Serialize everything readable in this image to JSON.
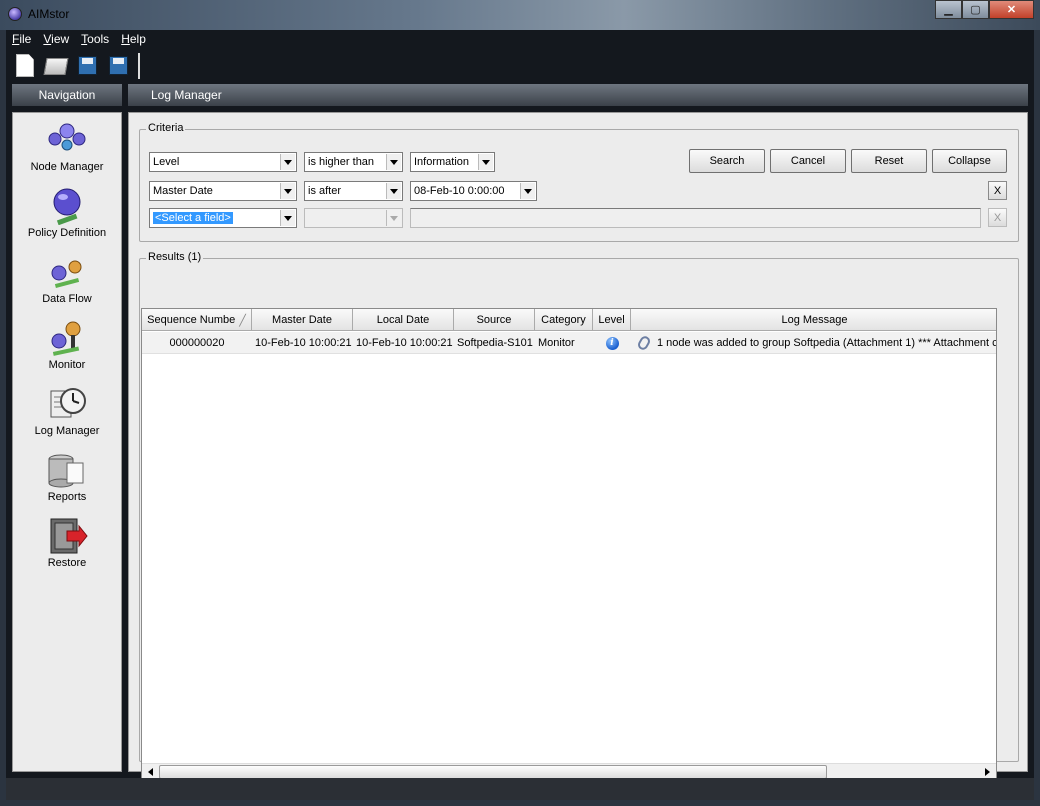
{
  "window": {
    "title": "AIMstor",
    "icon": "app-orb-icon"
  },
  "menu": [
    {
      "label": "File"
    },
    {
      "label": "View"
    },
    {
      "label": "Tools"
    },
    {
      "label": "Help"
    }
  ],
  "toolbar": {
    "icons": [
      "new-document-icon",
      "open-folder-icon",
      "save-icon",
      "save-as-icon"
    ]
  },
  "navigation": {
    "header": "Navigation",
    "items": [
      {
        "label": "Node Manager",
        "icon": "node-manager-icon"
      },
      {
        "label": "Policy Definition",
        "icon": "policy-definition-icon"
      },
      {
        "label": "Data Flow",
        "icon": "data-flow-icon"
      },
      {
        "label": "Monitor",
        "icon": "monitor-icon"
      },
      {
        "label": "Log Manager",
        "icon": "log-manager-icon"
      },
      {
        "label": "Reports",
        "icon": "reports-icon"
      },
      {
        "label": "Restore",
        "icon": "restore-icon"
      }
    ]
  },
  "main": {
    "header": "Log Manager",
    "criteria": {
      "label": "Criteria",
      "rows": [
        {
          "field": "Level",
          "operator": "is higher than",
          "value": "Information"
        },
        {
          "field": "Master Date",
          "operator": "is after",
          "value": "08-Feb-10 0:00:00"
        },
        {
          "field": "<Select a field>",
          "operator": "",
          "value": ""
        }
      ],
      "buttons": {
        "search": "Search",
        "cancel": "Cancel",
        "reset": "Reset",
        "collapse": "Collapse"
      },
      "remove_label": "X"
    },
    "results": {
      "label": "Results (1)",
      "columns": [
        "Sequence Numbe",
        "Master Date",
        "Local Date",
        "Source",
        "Category",
        "Level",
        "Log Message"
      ],
      "rows": [
        {
          "sequence": "000000020",
          "master_date": "10-Feb-10 10:00:21",
          "local_date": "10-Feb-10 10:00:21",
          "source": "Softpedia-S101",
          "category": "Monitor",
          "level_icon": "info-icon",
          "message": "1 node was added to group Softpedia (Attachment 1) *** Attachment c"
        }
      ]
    }
  },
  "colors": {
    "frame": "#14181e",
    "panel": "#ececec",
    "selection": "#3399ff"
  }
}
